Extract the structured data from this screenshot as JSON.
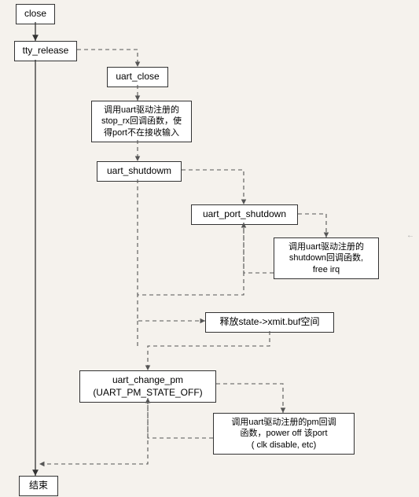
{
  "nodes": {
    "n_close": {
      "text": "close"
    },
    "n_tty_release": {
      "text": "tty_release"
    },
    "n_uart_close": {
      "text": "uart_close"
    },
    "n_stop_rx": {
      "text": "调用uart驱动注册的\nstop_rx回调函数，使\n得port不在接收输入"
    },
    "n_uart_shut": {
      "text": "uart_shutdowm"
    },
    "n_port_shut": {
      "text": "uart_port_shutdown"
    },
    "n_shutdown_cb": {
      "text": "调用uart驱动注册的\nshutdown回调函数,\nfree irq"
    },
    "n_free_xmit": {
      "text": "释放state->xmit.buf空间"
    },
    "n_change_pm": {
      "text": "uart_change_pm\n(UART_PM_STATE_OFF)"
    },
    "n_pm_cb": {
      "text": "调用uart驱动注册的pm回调\n函数，power off 该port\n( clk disable, etc)"
    },
    "n_end": {
      "text": "结束"
    }
  },
  "watermark": "←"
}
